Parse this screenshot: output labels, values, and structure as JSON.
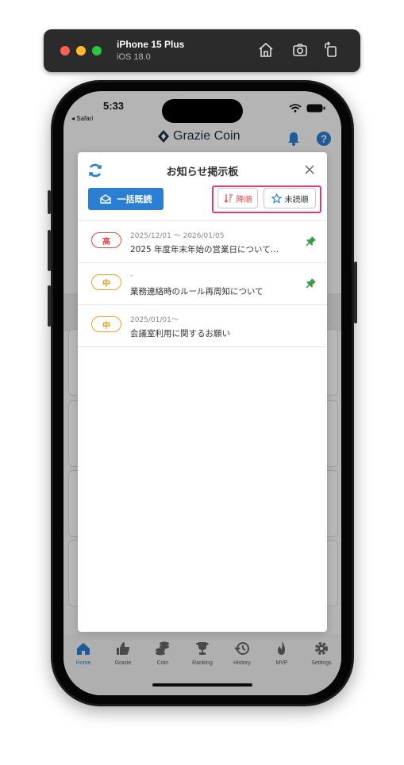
{
  "simulator": {
    "device_name": "iPhone 15 Plus",
    "os_version": "iOS 18.0",
    "icons": [
      "home-icon",
      "screenshot-icon",
      "rotate-icon"
    ]
  },
  "status_bar": {
    "time": "5:33",
    "back_app": "◂ Safari"
  },
  "header": {
    "brand": "Grazie Coin",
    "icons": [
      "bell-icon",
      "help-icon"
    ]
  },
  "modal": {
    "title": "お知らせ掲示板",
    "mark_all_read_label": "一括既読",
    "sort_desc_label": "降順",
    "sort_unread_label": "未読順",
    "items": [
      {
        "priority": "高",
        "level": "high",
        "date": "2025/12/01 ～ 2026/01/05",
        "title": "2025 年度年末年始の営業日について…",
        "pinned": true
      },
      {
        "priority": "中",
        "level": "medium",
        "date": "-",
        "title": "業務連絡時のルール再周知について",
        "pinned": true
      },
      {
        "priority": "中",
        "level": "medium",
        "date": "2025/01/01～",
        "title": "会議室利用に関するお願い",
        "pinned": false
      }
    ]
  },
  "tabbar": {
    "tabs": [
      {
        "label": "Home",
        "active": true
      },
      {
        "label": "Grazie",
        "active": false
      },
      {
        "label": "Coin",
        "active": false
      },
      {
        "label": "Ranking",
        "active": false
      },
      {
        "label": "History",
        "active": false
      },
      {
        "label": "MVP",
        "active": false
      },
      {
        "label": "Settings",
        "active": false
      }
    ]
  },
  "colors": {
    "accent": "#2a7fd4",
    "high_priority": "#e24b4b",
    "medium_priority": "#f0a227",
    "pin": "#3a9a4a",
    "highlight_box": "#e8387a"
  }
}
